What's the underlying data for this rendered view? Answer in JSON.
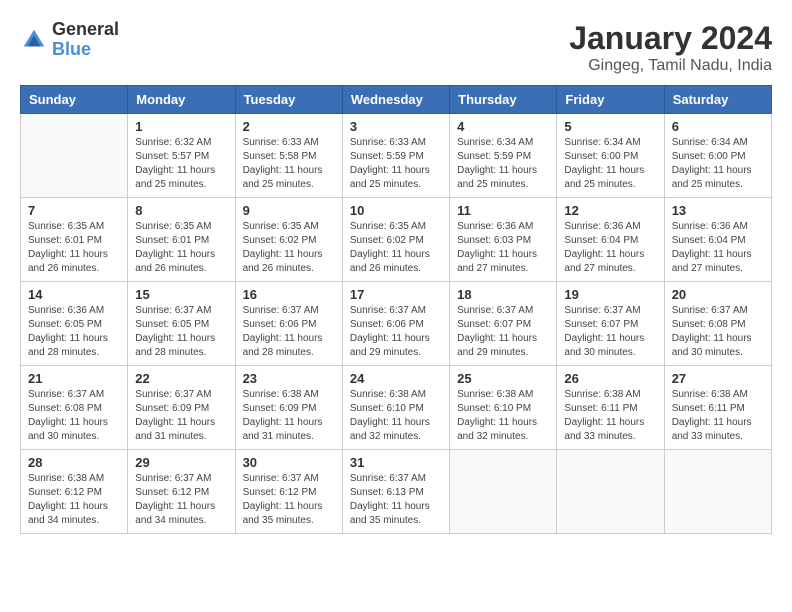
{
  "header": {
    "logo_line1": "General",
    "logo_line2": "Blue",
    "title": "January 2024",
    "subtitle": "Gingeg, Tamil Nadu, India"
  },
  "weekdays": [
    "Sunday",
    "Monday",
    "Tuesday",
    "Wednesday",
    "Thursday",
    "Friday",
    "Saturday"
  ],
  "weeks": [
    [
      {
        "day": "",
        "sunrise": "",
        "sunset": "",
        "daylight": ""
      },
      {
        "day": "1",
        "sunrise": "Sunrise: 6:32 AM",
        "sunset": "Sunset: 5:57 PM",
        "daylight": "Daylight: 11 hours and 25 minutes."
      },
      {
        "day": "2",
        "sunrise": "Sunrise: 6:33 AM",
        "sunset": "Sunset: 5:58 PM",
        "daylight": "Daylight: 11 hours and 25 minutes."
      },
      {
        "day": "3",
        "sunrise": "Sunrise: 6:33 AM",
        "sunset": "Sunset: 5:59 PM",
        "daylight": "Daylight: 11 hours and 25 minutes."
      },
      {
        "day": "4",
        "sunrise": "Sunrise: 6:34 AM",
        "sunset": "Sunset: 5:59 PM",
        "daylight": "Daylight: 11 hours and 25 minutes."
      },
      {
        "day": "5",
        "sunrise": "Sunrise: 6:34 AM",
        "sunset": "Sunset: 6:00 PM",
        "daylight": "Daylight: 11 hours and 25 minutes."
      },
      {
        "day": "6",
        "sunrise": "Sunrise: 6:34 AM",
        "sunset": "Sunset: 6:00 PM",
        "daylight": "Daylight: 11 hours and 25 minutes."
      }
    ],
    [
      {
        "day": "7",
        "sunrise": "Sunrise: 6:35 AM",
        "sunset": "Sunset: 6:01 PM",
        "daylight": "Daylight: 11 hours and 26 minutes."
      },
      {
        "day": "8",
        "sunrise": "Sunrise: 6:35 AM",
        "sunset": "Sunset: 6:01 PM",
        "daylight": "Daylight: 11 hours and 26 minutes."
      },
      {
        "day": "9",
        "sunrise": "Sunrise: 6:35 AM",
        "sunset": "Sunset: 6:02 PM",
        "daylight": "Daylight: 11 hours and 26 minutes."
      },
      {
        "day": "10",
        "sunrise": "Sunrise: 6:35 AM",
        "sunset": "Sunset: 6:02 PM",
        "daylight": "Daylight: 11 hours and 26 minutes."
      },
      {
        "day": "11",
        "sunrise": "Sunrise: 6:36 AM",
        "sunset": "Sunset: 6:03 PM",
        "daylight": "Daylight: 11 hours and 27 minutes."
      },
      {
        "day": "12",
        "sunrise": "Sunrise: 6:36 AM",
        "sunset": "Sunset: 6:04 PM",
        "daylight": "Daylight: 11 hours and 27 minutes."
      },
      {
        "day": "13",
        "sunrise": "Sunrise: 6:36 AM",
        "sunset": "Sunset: 6:04 PM",
        "daylight": "Daylight: 11 hours and 27 minutes."
      }
    ],
    [
      {
        "day": "14",
        "sunrise": "Sunrise: 6:36 AM",
        "sunset": "Sunset: 6:05 PM",
        "daylight": "Daylight: 11 hours and 28 minutes."
      },
      {
        "day": "15",
        "sunrise": "Sunrise: 6:37 AM",
        "sunset": "Sunset: 6:05 PM",
        "daylight": "Daylight: 11 hours and 28 minutes."
      },
      {
        "day": "16",
        "sunrise": "Sunrise: 6:37 AM",
        "sunset": "Sunset: 6:06 PM",
        "daylight": "Daylight: 11 hours and 28 minutes."
      },
      {
        "day": "17",
        "sunrise": "Sunrise: 6:37 AM",
        "sunset": "Sunset: 6:06 PM",
        "daylight": "Daylight: 11 hours and 29 minutes."
      },
      {
        "day": "18",
        "sunrise": "Sunrise: 6:37 AM",
        "sunset": "Sunset: 6:07 PM",
        "daylight": "Daylight: 11 hours and 29 minutes."
      },
      {
        "day": "19",
        "sunrise": "Sunrise: 6:37 AM",
        "sunset": "Sunset: 6:07 PM",
        "daylight": "Daylight: 11 hours and 30 minutes."
      },
      {
        "day": "20",
        "sunrise": "Sunrise: 6:37 AM",
        "sunset": "Sunset: 6:08 PM",
        "daylight": "Daylight: 11 hours and 30 minutes."
      }
    ],
    [
      {
        "day": "21",
        "sunrise": "Sunrise: 6:37 AM",
        "sunset": "Sunset: 6:08 PM",
        "daylight": "Daylight: 11 hours and 30 minutes."
      },
      {
        "day": "22",
        "sunrise": "Sunrise: 6:37 AM",
        "sunset": "Sunset: 6:09 PM",
        "daylight": "Daylight: 11 hours and 31 minutes."
      },
      {
        "day": "23",
        "sunrise": "Sunrise: 6:38 AM",
        "sunset": "Sunset: 6:09 PM",
        "daylight": "Daylight: 11 hours and 31 minutes."
      },
      {
        "day": "24",
        "sunrise": "Sunrise: 6:38 AM",
        "sunset": "Sunset: 6:10 PM",
        "daylight": "Daylight: 11 hours and 32 minutes."
      },
      {
        "day": "25",
        "sunrise": "Sunrise: 6:38 AM",
        "sunset": "Sunset: 6:10 PM",
        "daylight": "Daylight: 11 hours and 32 minutes."
      },
      {
        "day": "26",
        "sunrise": "Sunrise: 6:38 AM",
        "sunset": "Sunset: 6:11 PM",
        "daylight": "Daylight: 11 hours and 33 minutes."
      },
      {
        "day": "27",
        "sunrise": "Sunrise: 6:38 AM",
        "sunset": "Sunset: 6:11 PM",
        "daylight": "Daylight: 11 hours and 33 minutes."
      }
    ],
    [
      {
        "day": "28",
        "sunrise": "Sunrise: 6:38 AM",
        "sunset": "Sunset: 6:12 PM",
        "daylight": "Daylight: 11 hours and 34 minutes."
      },
      {
        "day": "29",
        "sunrise": "Sunrise: 6:37 AM",
        "sunset": "Sunset: 6:12 PM",
        "daylight": "Daylight: 11 hours and 34 minutes."
      },
      {
        "day": "30",
        "sunrise": "Sunrise: 6:37 AM",
        "sunset": "Sunset: 6:12 PM",
        "daylight": "Daylight: 11 hours and 35 minutes."
      },
      {
        "day": "31",
        "sunrise": "Sunrise: 6:37 AM",
        "sunset": "Sunset: 6:13 PM",
        "daylight": "Daylight: 11 hours and 35 minutes."
      },
      {
        "day": "",
        "sunrise": "",
        "sunset": "",
        "daylight": ""
      },
      {
        "day": "",
        "sunrise": "",
        "sunset": "",
        "daylight": ""
      },
      {
        "day": "",
        "sunrise": "",
        "sunset": "",
        "daylight": ""
      }
    ]
  ]
}
